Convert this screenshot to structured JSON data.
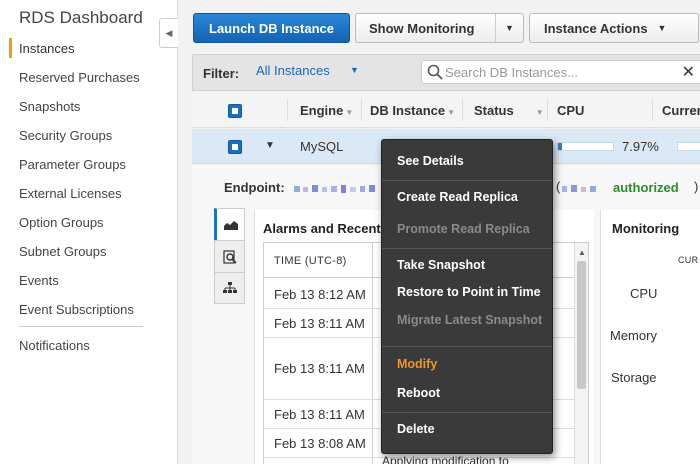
{
  "sidebar": {
    "title": "RDS Dashboard",
    "items": [
      {
        "label": "Instances",
        "active": true
      },
      {
        "label": "Reserved Purchases"
      },
      {
        "label": "Snapshots"
      },
      {
        "label": "Security Groups"
      },
      {
        "label": "Parameter Groups"
      },
      {
        "label": "External Licenses"
      },
      {
        "label": "Option Groups"
      },
      {
        "label": "Subnet Groups"
      },
      {
        "label": "Events"
      },
      {
        "label": "Event Subscriptions"
      },
      {
        "label": "Notifications"
      }
    ]
  },
  "toolbar": {
    "launch_label": "Launch DB Instance",
    "show_monitoring_label": "Show Monitoring",
    "instance_actions_label": "Instance Actions"
  },
  "filter": {
    "label": "Filter:",
    "value": "All Instances",
    "search_placeholder": "Search DB Instances..."
  },
  "table": {
    "headers": [
      "Engine",
      "DB Instance",
      "Status",
      "CPU",
      "Curren"
    ],
    "selected_row": {
      "engine": "MySQL",
      "cpu_percent_label": "7.97%",
      "cpu_fraction": 0.0797
    }
  },
  "details": {
    "endpoint_label": "Endpoint:",
    "open_paren": "(",
    "authorized_text": "authorized",
    "close_paren": ")",
    "alarms": {
      "title": "Alarms and Recent",
      "time_header": "TIME (UTC-8)",
      "rows": [
        "Feb 13 8:12 AM",
        "Feb 13 8:11 AM",
        "Feb 13 8:11 AM",
        "Feb 13 8:11 AM",
        "Feb 13 8:08 AM"
      ],
      "partial_text": "Applying modification to"
    },
    "monitoring": {
      "title": "Monitoring",
      "current_header": "CUR",
      "metrics": [
        "CPU",
        "Memory",
        "Storage"
      ]
    }
  },
  "context_menu": {
    "items": [
      {
        "label": "See Details"
      },
      {
        "label": "Create Read Replica"
      },
      {
        "label": "Promote Read Replica",
        "disabled": true
      },
      {
        "label": "Take Snapshot"
      },
      {
        "label": "Restore to Point in Time"
      },
      {
        "label": "Migrate Latest Snapshot",
        "disabled": true
      },
      {
        "label": "Modify",
        "highlighted": true
      },
      {
        "label": "Reboot"
      },
      {
        "label": "Delete"
      }
    ]
  },
  "colors": {
    "primary": "#1a74c6",
    "accent_orange": "#f0932b",
    "authorized_green": "#2e8b2e",
    "menu_bg": "#3a3a3a"
  },
  "icons": [
    "chevron-left-icon",
    "chevron-down-icon",
    "search-icon",
    "close-icon",
    "area-chart-icon",
    "magnify-page-icon",
    "hierarchy-icon",
    "caret-down-icon"
  ]
}
